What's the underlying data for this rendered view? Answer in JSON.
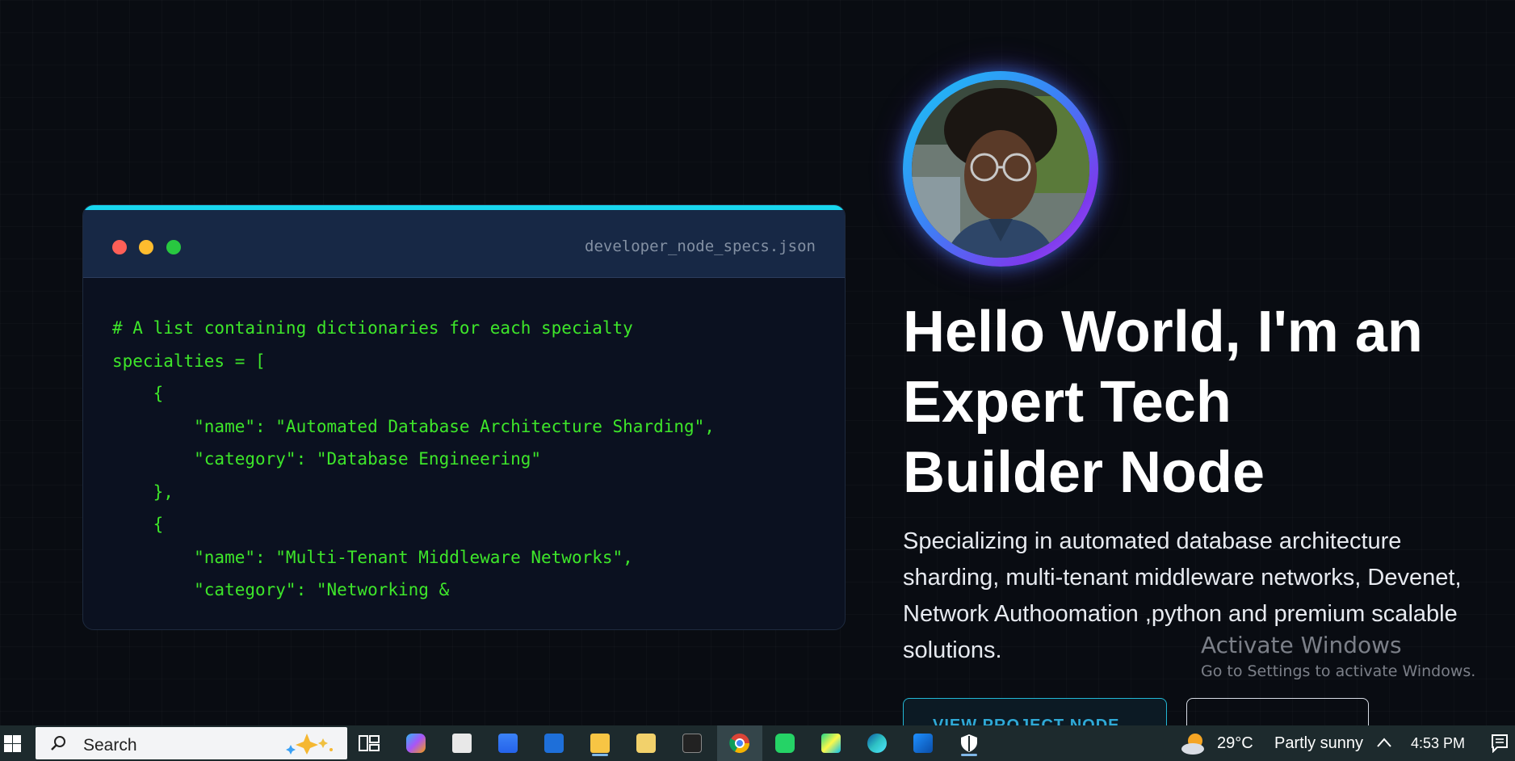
{
  "code_window": {
    "filename": "developer_node_specs.json",
    "lines": [
      "# A list containing dictionaries for each specialty",
      "specialties = [",
      "    {",
      "        \"name\": \"Automated Database Architecture Sharding\",",
      "        \"category\": \"Database Engineering\"",
      "    },",
      "    {",
      "        \"name\": \"Multi-Tenant Middleware Networks\",",
      "        \"category\": \"Networking &"
    ]
  },
  "hero": {
    "title_lines": [
      "Hello World, I'm an",
      "Expert Tech",
      "Builder Node"
    ],
    "description": "Specializing in automated database architecture sharding, multi-tenant middleware networks, Devenet, Network Authoomation ,python and premium scalable solutions.",
    "primary_button": "VIEW PROJECT NODE",
    "secondary_button": ""
  },
  "watermark": {
    "title": "Activate Windows",
    "subtitle": "Go to Settings to activate Windows."
  },
  "taskbar": {
    "search_placeholder": "Search",
    "apps": [
      "task-view",
      "copilot",
      "file-manager",
      "microsoft-store",
      "outlook",
      "file-explorer",
      "notepad",
      "terminal",
      "chrome",
      "whatsapp",
      "pycharm",
      "edge",
      "photos",
      "security"
    ],
    "weather": {
      "temp": "29°C",
      "condition": "Partly sunny"
    },
    "time": "4:53 PM"
  },
  "colors": {
    "background": "#090c12",
    "code_green": "#3ee62a",
    "accent_cyan": "#18d6ee",
    "accent_purple": "#7c3aed"
  }
}
